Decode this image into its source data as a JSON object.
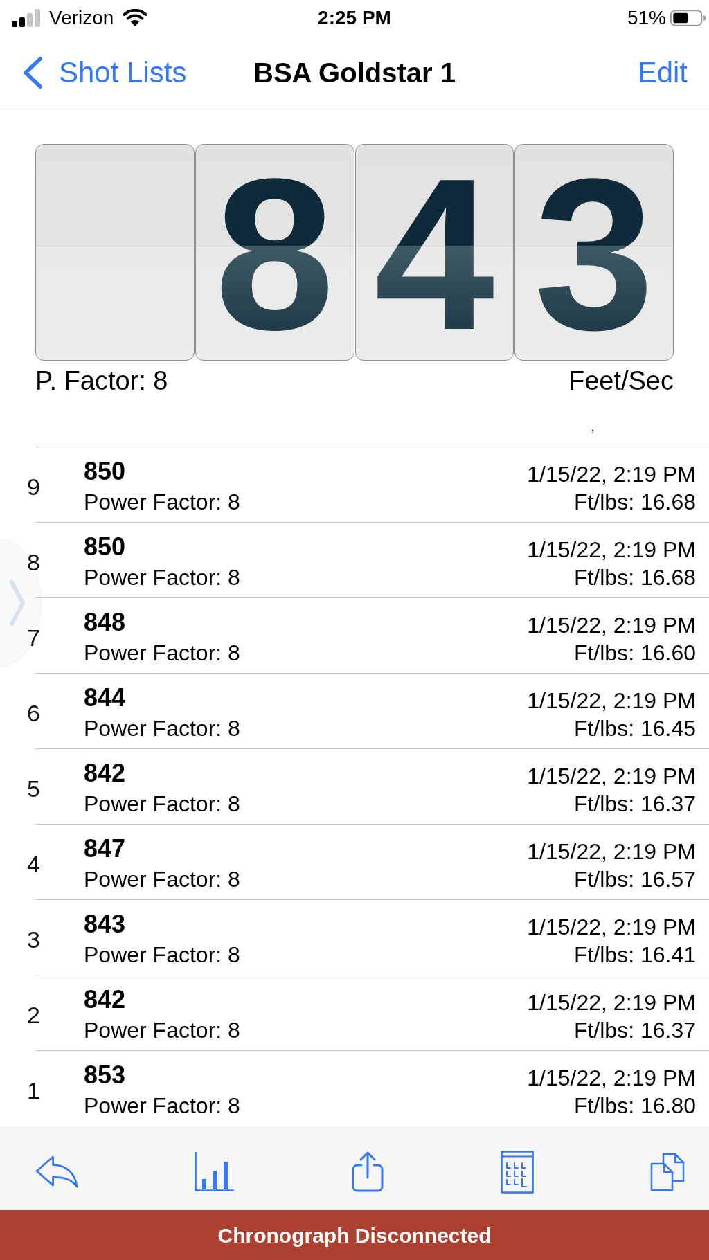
{
  "status_bar": {
    "carrier": "Verizon",
    "time": "2:25 PM",
    "battery": "51%"
  },
  "nav_bar": {
    "back": "Shot Lists",
    "title": "BSA Goldstar 1",
    "action": "Edit"
  },
  "display": {
    "panels": [
      {
        "kind": "blank"
      },
      {
        "kind": "digit",
        "digit": "8"
      },
      {
        "kind": "digit",
        "digit": "4"
      },
      {
        "kind": "digit",
        "digit": "3"
      }
    ],
    "power_factor": "P. Factor: 8",
    "unit": "Feet/Sec"
  },
  "header_mark": ",",
  "shots": [
    {
      "index": "9",
      "velocity": "850",
      "power_factor": "Power Factor: 8",
      "time": "1/15/22, 2:19 PM",
      "energy": "Ft/lbs: 16.68"
    },
    {
      "index": "8",
      "velocity": "850",
      "power_factor": "Power Factor: 8",
      "time": "1/15/22, 2:19 PM",
      "energy": "Ft/lbs: 16.68"
    },
    {
      "index": "7",
      "velocity": "848",
      "power_factor": "Power Factor: 8",
      "time": "1/15/22, 2:19 PM",
      "energy": "Ft/lbs: 16.60"
    },
    {
      "index": "6",
      "velocity": "844",
      "power_factor": "Power Factor: 8",
      "time": "1/15/22, 2:19 PM",
      "energy": "Ft/lbs: 16.45"
    },
    {
      "index": "5",
      "velocity": "842",
      "power_factor": "Power Factor: 8",
      "time": "1/15/22, 2:19 PM",
      "energy": "Ft/lbs: 16.37"
    },
    {
      "index": "4",
      "velocity": "847",
      "power_factor": "Power Factor: 8",
      "time": "1/15/22, 2:19 PM",
      "energy": "Ft/lbs: 16.57"
    },
    {
      "index": "3",
      "velocity": "843",
      "power_factor": "Power Factor: 8",
      "time": "1/15/22, 2:19 PM",
      "energy": "Ft/lbs: 16.41"
    },
    {
      "index": "2",
      "velocity": "842",
      "power_factor": "Power Factor: 8",
      "time": "1/15/22, 2:19 PM",
      "energy": "Ft/lbs: 16.37"
    },
    {
      "index": "1",
      "velocity": "853",
      "power_factor": "Power Factor: 8",
      "time": "1/15/22, 2:19 PM",
      "energy": "Ft/lbs: 16.80"
    }
  ],
  "banner": {
    "text": "Chronograph Disconnected"
  }
}
